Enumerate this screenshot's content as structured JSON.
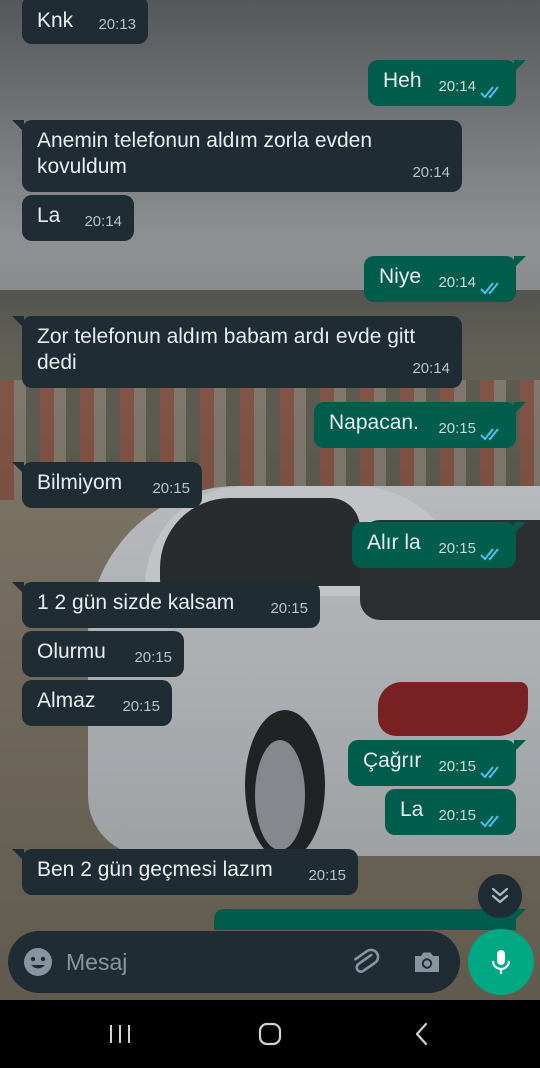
{
  "messages": [
    {
      "dir": "in",
      "text": "Knk",
      "time": "20:13"
    },
    {
      "dir": "out",
      "text": "Heh",
      "time": "20:14",
      "status": "read"
    },
    {
      "dir": "in",
      "lines": [
        "Anemin telefonun aldım zorla evden",
        "kovuldum"
      ],
      "time": "20:14"
    },
    {
      "dir": "in",
      "text": "La",
      "time": "20:14"
    },
    {
      "dir": "out",
      "text": "Niye",
      "time": "20:14",
      "status": "read"
    },
    {
      "dir": "in",
      "lines": [
        "Zor telefonun aldım babam ardı evde gitt",
        "dedi"
      ],
      "time": "20:14"
    },
    {
      "dir": "out",
      "text": "Napacan.",
      "time": "20:15",
      "status": "read"
    },
    {
      "dir": "in",
      "text": "Bilmiyom",
      "time": "20:15"
    },
    {
      "dir": "out",
      "text": "Alır la",
      "time": "20:15",
      "status": "read"
    },
    {
      "dir": "in",
      "text": "1 2 gün sizde kalsam",
      "time": "20:15"
    },
    {
      "dir": "in",
      "text": "Olurmu",
      "time": "20:15"
    },
    {
      "dir": "in",
      "text": "Almaz",
      "time": "20:15"
    },
    {
      "dir": "out",
      "text": "Çağrır",
      "time": "20:15",
      "status": "read"
    },
    {
      "dir": "out",
      "text": "La",
      "time": "20:15",
      "status": "read"
    },
    {
      "dir": "in",
      "text": "Ben 2 gün geçmesi lazım",
      "time": "20:15"
    }
  ],
  "composer": {
    "placeholder": "Mesaj",
    "emoji_icon": "emoji-icon",
    "attach_icon": "paperclip-icon",
    "camera_icon": "camera-icon",
    "mic_icon": "microphone-icon"
  },
  "scroll_down_icon": "double-chevron-down-icon",
  "nav": [
    "recent-apps-icon",
    "home-icon",
    "back-icon"
  ],
  "colors": {
    "incoming_bubble": "#1f2c34",
    "outgoing_bubble": "#005c4b",
    "accent": "#00a884",
    "read_ticks": "#53bdeb"
  }
}
